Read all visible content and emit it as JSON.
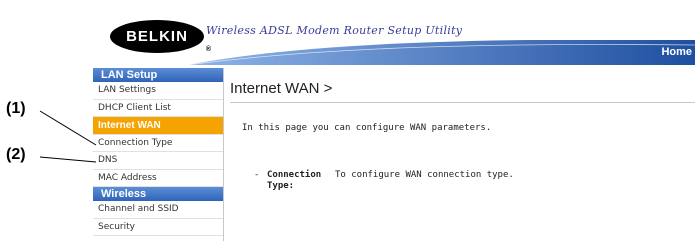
{
  "header": {
    "logo_text": "BELKIN",
    "logo_mark": "®",
    "title": "Wireless ADSL Modem Router Setup Utility",
    "home_label": "Home",
    "brand_color": "#2f63b8"
  },
  "sidebar": {
    "sections": [
      {
        "title": "LAN Setup",
        "items": [
          {
            "label": "LAN Settings"
          },
          {
            "label": "DHCP Client List"
          },
          {
            "label": "Internet WAN",
            "active": true
          },
          {
            "label": "Connection Type"
          },
          {
            "label": "DNS"
          },
          {
            "label": "MAC Address"
          }
        ]
      },
      {
        "title": "Wireless",
        "items": [
          {
            "label": "Channel and SSID"
          },
          {
            "label": "Security"
          }
        ]
      }
    ],
    "active_color": "#f5a300"
  },
  "main": {
    "title": "Internet WAN >",
    "intro": "In this page you can configure WAN parameters.",
    "entries": [
      {
        "dash": "-",
        "term": "Connection Type:",
        "description": "To configure WAN connection type."
      }
    ]
  },
  "callouts": [
    {
      "label": "(1)"
    },
    {
      "label": "(2)"
    }
  ]
}
